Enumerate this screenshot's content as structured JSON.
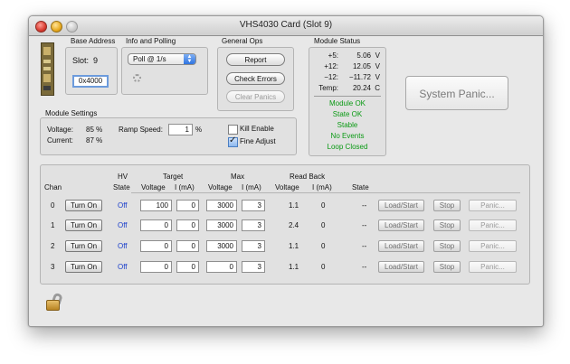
{
  "window": {
    "title": "VHS4030 Card (Slot 9)"
  },
  "base_address": {
    "heading": "Base Address",
    "slot_label": "Slot:",
    "slot_value": "9",
    "address": "0x4000"
  },
  "info_polling": {
    "heading": "Info and Polling",
    "poll_value": "Poll @ 1/s"
  },
  "general_ops": {
    "heading": "General Ops",
    "report": "Report",
    "check_errors": "Check Errors",
    "clear_panics": "Clear Panics"
  },
  "module_status": {
    "heading": "Module Status",
    "rows": [
      {
        "label": "+5:",
        "value": "5.06",
        "unit": "V"
      },
      {
        "label": "+12:",
        "value": "12.05",
        "unit": "V"
      },
      {
        "label": "−12:",
        "value": "−11.72",
        "unit": "V"
      },
      {
        "label": "Temp:",
        "value": "20.24",
        "unit": "C"
      }
    ],
    "messages": [
      "Module OK",
      "State OK",
      "Stable",
      "No Events",
      "Loop Closed"
    ],
    "ok_color": "#0a9a14"
  },
  "system_panic": "System Panic...",
  "module_settings": {
    "heading": "Module Settings",
    "voltage_label": "Voltage:",
    "voltage_value": "85 %",
    "current_label": "Current:",
    "current_value": "87 %",
    "ramp_label": "Ramp Speed:",
    "ramp_value": "1",
    "ramp_unit": "%",
    "kill_enable": "Kill Enable",
    "kill_enable_checked": false,
    "fine_adjust": "Fine Adjust",
    "fine_adjust_checked": true
  },
  "table": {
    "headers": {
      "chan": "Chan",
      "hv": "HV",
      "state": "State",
      "target": "Target",
      "max": "Max",
      "readback": "Read Back",
      "voltage": "Voltage",
      "current": "I (mA)",
      "state_col": "State"
    },
    "rows": [
      {
        "chan": "0",
        "btn": "Turn On",
        "hv": "Off",
        "tv": "100",
        "ti": "0",
        "mv": "3000",
        "mi": "3",
        "rv": "1.1",
        "ri": "0",
        "st": "--",
        "load": "Load/Start",
        "stop": "Stop",
        "panic": "Panic..."
      },
      {
        "chan": "1",
        "btn": "Turn On",
        "hv": "Off",
        "tv": "0",
        "ti": "0",
        "mv": "3000",
        "mi": "3",
        "rv": "2.4",
        "ri": "0",
        "st": "--",
        "load": "Load/Start",
        "stop": "Stop",
        "panic": "Panic..."
      },
      {
        "chan": "2",
        "btn": "Turn On",
        "hv": "Off",
        "tv": "0",
        "ti": "0",
        "mv": "3000",
        "mi": "3",
        "rv": "1.1",
        "ri": "0",
        "st": "--",
        "load": "Load/Start",
        "stop": "Stop",
        "panic": "Panic..."
      },
      {
        "chan": "3",
        "btn": "Turn On",
        "hv": "Off",
        "tv": "0",
        "ti": "0",
        "mv": "0",
        "mi": "3",
        "rv": "1.1",
        "ri": "0",
        "st": "--",
        "load": "Load/Start",
        "stop": "Stop",
        "panic": "Panic..."
      }
    ]
  }
}
